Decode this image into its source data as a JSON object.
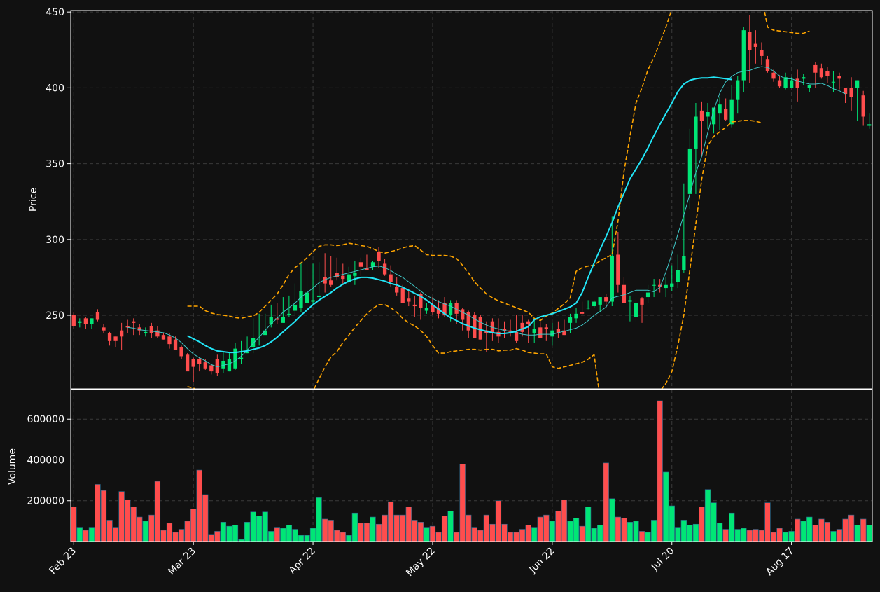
{
  "colors": {
    "background": "#111111",
    "up": "#00e676",
    "down": "#ff4d4d",
    "sma_slow": "#22e6f7",
    "sma_fast": "#40c8c8",
    "bollinger": "#ffa500",
    "grid": "#3a3a3a",
    "axis": "#ffffff"
  },
  "chart_data": [
    {
      "type": "candlestick",
      "panel": "price",
      "ylabel": "Price",
      "ylim": [
        201.5,
        451
      ],
      "yticks": [
        250,
        300,
        350,
        400,
        450
      ],
      "grid": true,
      "dates": [
        "2024-02-23",
        "2024-02-26",
        "2024-02-27",
        "2024-02-28",
        "2024-02-29",
        "2024-03-01",
        "2024-03-04",
        "2024-03-05",
        "2024-03-06",
        "2024-03-07",
        "2024-03-08",
        "2024-03-11",
        "2024-03-12",
        "2024-03-13",
        "2024-03-14",
        "2024-03-15",
        "2024-03-18",
        "2024-03-19",
        "2024-03-20",
        "2024-03-21",
        "2024-03-22",
        "2024-03-25",
        "2024-03-26",
        "2024-03-27",
        "2024-03-28",
        "2024-03-29",
        "2024-04-01",
        "2024-04-02",
        "2024-04-03",
        "2024-04-04",
        "2024-04-05",
        "2024-04-08",
        "2024-04-09",
        "2024-04-10",
        "2024-04-11",
        "2024-04-12",
        "2024-04-15",
        "2024-04-16",
        "2024-04-17",
        "2024-04-18",
        "2024-04-19",
        "2024-04-22",
        "2024-04-23",
        "2024-04-24",
        "2024-04-25",
        "2024-04-26",
        "2024-04-29",
        "2024-04-30",
        "2024-05-01",
        "2024-05-02",
        "2024-05-03",
        "2024-05-06",
        "2024-05-07",
        "2024-05-08",
        "2024-05-09",
        "2024-05-10",
        "2024-05-13",
        "2024-05-14",
        "2024-05-15",
        "2024-05-16",
        "2024-05-17",
        "2024-05-20",
        "2024-05-21",
        "2024-05-22",
        "2024-05-23",
        "2024-05-24",
        "2024-05-27",
        "2024-05-28",
        "2024-05-29",
        "2024-05-30",
        "2024-05-31",
        "2024-06-03",
        "2024-06-04",
        "2024-06-05",
        "2024-06-06",
        "2024-06-07",
        "2024-06-10",
        "2024-06-11",
        "2024-06-12",
        "2024-06-13",
        "2024-06-14",
        "2024-06-17",
        "2024-06-18",
        "2024-06-19",
        "2024-06-20",
        "2024-06-21",
        "2024-06-24",
        "2024-06-25",
        "2024-06-26",
        "2024-06-27",
        "2024-06-28",
        "2024-07-01",
        "2024-07-02",
        "2024-07-03",
        "2024-07-04",
        "2024-07-05",
        "2024-07-08",
        "2024-07-09",
        "2024-07-10",
        "2024-07-11",
        "2024-07-12",
        "2024-07-15",
        "2024-07-16",
        "2024-07-17",
        "2024-07-18",
        "2024-07-19",
        "2024-07-22",
        "2024-07-23",
        "2024-07-24",
        "2024-07-25",
        "2024-07-26",
        "2024-07-29",
        "2024-07-30",
        "2024-07-31",
        "2024-08-01",
        "2024-08-02",
        "2024-08-05",
        "2024-08-06",
        "2024-08-07",
        "2024-08-08",
        "2024-08-09",
        "2024-08-12",
        "2024-08-13",
        "2024-08-14",
        "2024-08-15",
        "2024-08-16",
        "2024-08-19",
        "2024-08-20",
        "2024-08-21",
        "2024-08-22",
        "2024-08-23",
        "2024-08-26"
      ],
      "open": [
        250,
        245,
        248,
        244,
        252,
        242,
        238,
        236,
        240,
        243,
        246,
        242,
        238,
        243,
        240,
        237,
        236,
        234,
        229,
        224,
        221,
        221,
        219,
        217,
        221,
        215,
        213,
        215,
        221,
        225,
        229,
        232,
        237,
        244,
        248,
        245,
        250,
        253,
        255,
        258,
        259,
        262,
        275,
        273,
        278,
        276,
        272,
        276,
        285,
        281,
        282,
        292,
        284,
        277,
        269,
        268,
        261,
        257,
        264,
        253,
        257,
        255,
        258,
        250,
        258,
        254,
        252,
        250,
        249,
        240,
        246,
        239,
        241,
        240,
        239,
        245,
        246,
        238,
        242,
        242,
        236,
        241,
        240,
        245,
        248,
        252,
        255,
        256,
        257,
        262,
        259,
        290,
        270,
        259,
        249,
        261,
        262,
        270,
        270,
        268,
        269,
        272,
        280,
        330,
        360,
        385,
        381,
        376,
        383,
        386,
        376,
        392,
        405,
        437,
        429,
        425,
        419,
        410,
        405,
        400,
        400,
        406,
        406,
        400,
        415,
        413,
        411,
        404,
        408,
        400,
        400,
        400,
        395,
        375
      ],
      "high": [
        252,
        248,
        249,
        248,
        254,
        244,
        239,
        236,
        245,
        247,
        248,
        244,
        242,
        245,
        243,
        238,
        238,
        236,
        230,
        225,
        222,
        222,
        221,
        218,
        224,
        226,
        225,
        232,
        233,
        236,
        248,
        251,
        251,
        257,
        258,
        262,
        263,
        271,
        285,
        286,
        284,
        285,
        291,
        289,
        288,
        284,
        282,
        286,
        288,
        290,
        286,
        295,
        287,
        283,
        275,
        270,
        266,
        263,
        265,
        258,
        262,
        260,
        262,
        260,
        260,
        255,
        253,
        252,
        250,
        246,
        248,
        248,
        246,
        247,
        250,
        250,
        247,
        247,
        246,
        244,
        245,
        246,
        247,
        251,
        255,
        259,
        260,
        260,
        261,
        264,
        315,
        305,
        275,
        263,
        261,
        262,
        270,
        274,
        274,
        275,
        283,
        290,
        337,
        373,
        390,
        391,
        390,
        384,
        394,
        393,
        402,
        408,
        440,
        448,
        438,
        430,
        421,
        412,
        408,
        410,
        407,
        412,
        409,
        402,
        417,
        416,
        414,
        411,
        410,
        400,
        407,
        405,
        398,
        383
      ],
      "low": [
        241,
        242,
        241,
        241,
        246,
        238,
        230,
        229,
        227,
        238,
        237,
        237,
        236,
        235,
        235,
        234,
        228,
        227,
        221,
        214,
        206,
        213,
        214,
        211,
        210,
        212,
        213,
        214,
        218,
        225,
        225,
        230,
        237,
        242,
        244,
        245,
        249,
        250,
        252,
        253,
        257,
        261,
        265,
        269,
        273,
        270,
        271,
        270,
        276,
        280,
        280,
        281,
        276,
        269,
        263,
        260,
        256,
        249,
        247,
        251,
        250,
        248,
        249,
        246,
        244,
        240,
        235,
        237,
        234,
        226,
        233,
        232,
        235,
        236,
        232,
        236,
        232,
        232,
        237,
        233,
        230,
        235,
        237,
        238,
        245,
        250,
        254,
        255,
        252,
        255,
        256,
        265,
        262,
        246,
        246,
        245,
        258,
        262,
        265,
        262,
        266,
        268,
        278,
        320,
        330,
        355,
        373,
        370,
        372,
        378,
        374,
        383,
        397,
        403,
        416,
        415,
        410,
        404,
        400,
        399,
        400,
        391,
        402,
        397,
        400,
        406,
        403,
        397,
        399,
        390,
        385,
        378,
        375,
        373
      ],
      "close": [
        243,
        246,
        244,
        248,
        247,
        240,
        233,
        233,
        236,
        242,
        245,
        240,
        239,
        238,
        236,
        234,
        231,
        227,
        223,
        213,
        216,
        218,
        215,
        213,
        212,
        220,
        221,
        228,
        222,
        226,
        235,
        232,
        240,
        249,
        247,
        249,
        251,
        257,
        266,
        265,
        260,
        263,
        271,
        270,
        275,
        274,
        277,
        278,
        282,
        280,
        285,
        286,
        277,
        272,
        265,
        258,
        259,
        256,
        255,
        255,
        252,
        251,
        250,
        258,
        251,
        247,
        240,
        235,
        234,
        238,
        238,
        236,
        240,
        239,
        233,
        239,
        244,
        241,
        235,
        241,
        240,
        238,
        237,
        249,
        251,
        251,
        255,
        259,
        262,
        259,
        289,
        270,
        258,
        260,
        258,
        257,
        265,
        270,
        269,
        270,
        271,
        280,
        289,
        360,
        381,
        378,
        384,
        387,
        389,
        379,
        392,
        405,
        438,
        425,
        427,
        421,
        411,
        406,
        401,
        407,
        405,
        400,
        407,
        402,
        410,
        407,
        408,
        404,
        406,
        396,
        394,
        405,
        381,
        376
      ],
      "volume": [
        170000,
        70000,
        55000,
        70000,
        280000,
        250000,
        105000,
        70000,
        245000,
        205000,
        170000,
        120000,
        100000,
        130000,
        295000,
        55000,
        90000,
        45000,
        60000,
        100000,
        160000,
        350000,
        230000,
        35000,
        50000,
        95000,
        75000,
        80000,
        10000,
        95000,
        145000,
        125000,
        145000,
        50000,
        70000,
        65000,
        80000,
        60000,
        30000,
        30000,
        65000,
        215000,
        110000,
        105000,
        55000,
        45000,
        30000,
        140000,
        90000,
        90000,
        120000,
        85000,
        130000,
        195000,
        130000,
        130000,
        170000,
        105000,
        95000,
        70000,
        75000,
        45000,
        125000,
        150000,
        45000,
        380000,
        130000,
        70000,
        55000,
        130000,
        85000,
        200000,
        85000,
        45000,
        45000,
        60000,
        80000,
        70000,
        120000,
        130000,
        100000,
        150000,
        205000,
        100000,
        115000,
        75000,
        170000,
        65000,
        80000,
        385000,
        210000,
        120000,
        115000,
        95000,
        100000,
        50000,
        45000,
        105000,
        690000,
        340000,
        175000,
        70000,
        105000,
        80000,
        85000,
        170000,
        255000,
        190000,
        90000,
        60000,
        140000,
        60000,
        65000,
        55000,
        60000,
        55000,
        190000,
        45000,
        65000,
        45000,
        50000,
        110000,
        100000,
        120000,
        80000,
        110000,
        95000,
        50000,
        60000,
        110000,
        130000,
        80000,
        110000,
        80000
      ],
      "sma_fast": [
        null,
        null,
        null,
        null,
        null,
        null,
        null,
        null,
        null,
        242,
        241.5,
        240.5,
        240,
        239.5,
        239,
        238.5,
        237,
        235,
        232,
        228,
        224.5,
        222,
        220,
        217.5,
        216,
        217,
        218,
        220,
        223,
        227,
        231.5,
        235.5,
        240,
        244.5,
        248,
        252,
        255,
        258,
        262,
        265,
        268,
        271.5,
        273.5,
        275,
        276,
        277,
        278,
        279,
        280,
        281,
        282,
        282.5,
        281.5,
        279.5,
        277,
        275,
        272,
        269,
        266,
        263,
        261,
        259,
        257.5,
        256,
        254,
        252,
        250,
        247.5,
        245.5,
        243.5,
        242,
        241,
        240,
        239.5,
        238.5,
        237.5,
        237,
        237,
        237.5,
        237.5,
        237.5,
        238.5,
        239.5,
        240.5,
        241.5,
        243.5,
        246.5,
        250,
        252.5,
        255.5,
        261.5,
        262.5,
        263.5,
        265,
        266.5,
        266.5,
        266.5,
        265.5,
        268.5,
        278.5,
        290.5,
        303.5,
        316,
        330,
        344,
        355,
        370.5,
        385.5,
        396.5,
        404,
        407.5,
        410,
        411,
        411.5,
        413,
        414,
        413.5,
        411,
        408,
        406,
        406,
        404.5,
        403.5,
        402.5,
        402.5,
        403,
        401.5,
        399.5,
        398,
        396
      ],
      "sma_slow": [
        null,
        null,
        null,
        null,
        null,
        null,
        null,
        null,
        null,
        null,
        null,
        null,
        null,
        null,
        null,
        null,
        null,
        null,
        null,
        236.5,
        234.5,
        232.5,
        230,
        228,
        226.5,
        226,
        225.5,
        225.5,
        226,
        226.5,
        227.5,
        228.5,
        230,
        232.5,
        235.5,
        239,
        242.5,
        246,
        250,
        253.5,
        257,
        260,
        262.5,
        265,
        268,
        270.5,
        272.5,
        274,
        275,
        275,
        274.5,
        273.5,
        272.5,
        271,
        270,
        268.5,
        266.5,
        264.5,
        262.5,
        260,
        257,
        254,
        251,
        248.5,
        246.5,
        244.5,
        243,
        241.5,
        240.5,
        239.5,
        238.5,
        238,
        238,
        238.5,
        239.5,
        241,
        242.5,
        247,
        249,
        250,
        251,
        252.5,
        254,
        255.5,
        258,
        265,
        275,
        284.5,
        293.5,
        302,
        311,
        321.5,
        330.5,
        340,
        346.5,
        353,
        360.5,
        368.5,
        376,
        383,
        390,
        397.5,
        402.5,
        405,
        406,
        406.5,
        406.5,
        407,
        406.5,
        406,
        405.5
      ],
      "boll_upper": [
        null,
        null,
        null,
        null,
        null,
        null,
        null,
        null,
        null,
        null,
        null,
        null,
        null,
        null,
        null,
        null,
        null,
        null,
        null,
        256,
        256,
        256,
        253,
        251.5,
        250.5,
        250,
        249.5,
        248.5,
        248,
        249,
        249.5,
        252,
        256,
        260,
        264,
        270,
        277,
        281.5,
        284.5,
        288,
        292,
        295.5,
        296.5,
        296.5,
        296,
        296.5,
        297.5,
        297,
        296,
        295.5,
        294,
        292,
        291,
        292,
        293,
        294.5,
        295.5,
        296,
        293,
        290,
        289.5,
        289.5,
        289.5,
        289,
        287.5,
        283,
        278,
        272,
        268,
        264,
        261.5,
        259.5,
        258,
        256.5,
        255,
        253.5,
        252,
        248,
        246.5,
        249.5,
        251.5,
        254.5,
        257.5,
        261.5,
        279,
        281.5,
        282.5,
        283,
        286,
        288,
        290,
        312,
        345,
        368,
        390,
        400,
        412,
        420,
        430,
        440,
        452,
        470,
        470,
        470,
        470,
        470,
        470,
        470,
        470,
        470,
        470,
        470,
        470,
        470,
        470,
        460,
        440,
        438,
        437.5,
        437,
        436.5,
        436,
        436,
        437.5
      ],
      "boll_lower": [
        null,
        null,
        null,
        null,
        null,
        null,
        null,
        null,
        null,
        null,
        null,
        null,
        null,
        null,
        null,
        null,
        null,
        null,
        null,
        203,
        202,
        200,
        199,
        198,
        198,
        198,
        197.5,
        198,
        198,
        197.5,
        196.5,
        195,
        194,
        193,
        192,
        191,
        190,
        190,
        190,
        194,
        200,
        208,
        216,
        222.5,
        226,
        232,
        237,
        242,
        246.5,
        251,
        254.5,
        257,
        257,
        255,
        252,
        248,
        245,
        243,
        240,
        236,
        230,
        225,
        225,
        226,
        226.5,
        227,
        227.5,
        227.5,
        227,
        227.5,
        227.5,
        226.5,
        227,
        227,
        228,
        227,
        225.5,
        225,
        224.5,
        224.5,
        216,
        215,
        216,
        217,
        218,
        219,
        221,
        224,
        195,
        160,
        140,
        130,
        120,
        115,
        120,
        140,
        160,
        180,
        200,
        205,
        213,
        230,
        250,
        280,
        310,
        340,
        362,
        368,
        371,
        374,
        377.5,
        378,
        378.5,
        378.5,
        378,
        377
      ]
    },
    {
      "type": "bar",
      "panel": "volume",
      "ylabel": "Volume",
      "ylim": [
        0,
        745000
      ],
      "yticks": [
        200000,
        400000,
        600000
      ],
      "xticklabels": [
        "Feb 23",
        "Mar 23",
        "Apr 22",
        "May 22",
        "Jun 22",
        "Jul 20",
        "Aug 17"
      ],
      "xtick_indices": [
        0,
        20,
        40,
        60,
        80,
        100,
        120
      ],
      "grid": true
    }
  ]
}
